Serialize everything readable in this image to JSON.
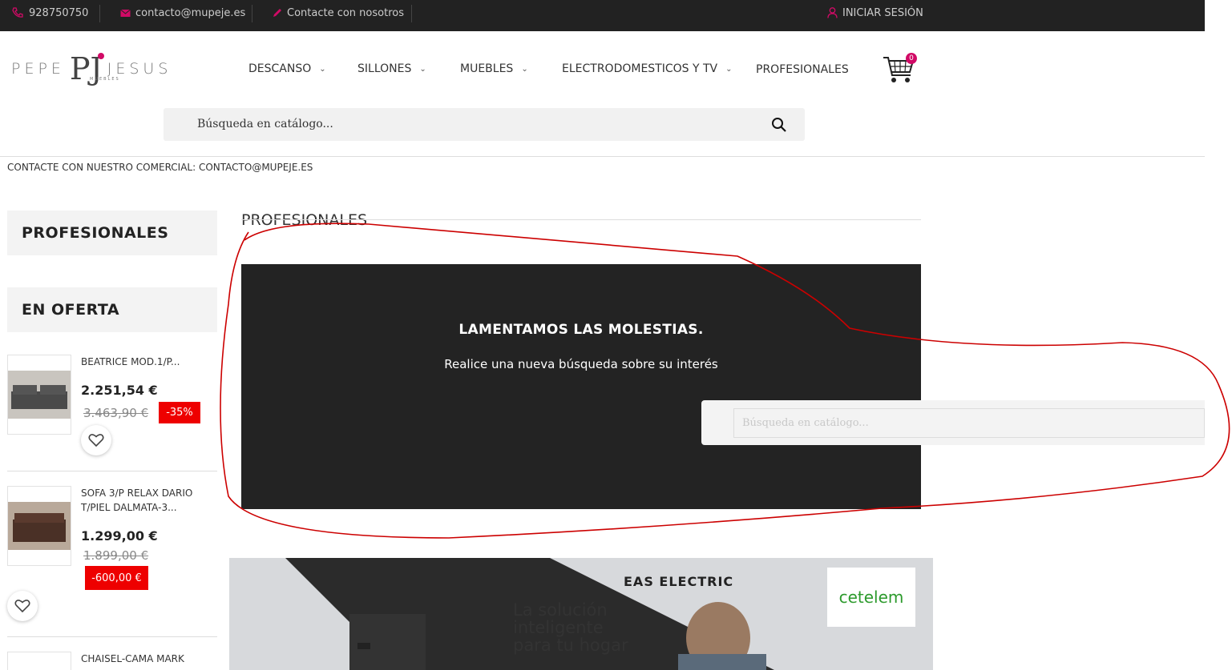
{
  "topbar": {
    "phone": "928750750",
    "email": "contacto@mupeje.es",
    "contact": "Contacte con nosotros",
    "login": "INICIAR SESIÓN"
  },
  "logo": {
    "left": "PEPE",
    "mark": "PJ",
    "right": "JESUS",
    "sub": "MUEBLES"
  },
  "nav": [
    {
      "label": "DESCANSO"
    },
    {
      "label": "SILLONES"
    },
    {
      "label": "MUEBLES"
    },
    {
      "label": "ELECTRODOMESTICOS Y TV"
    },
    {
      "label": "PROFESIONALES"
    }
  ],
  "cart": {
    "count": "0"
  },
  "search": {
    "placeholder": "Búsqueda en catálogo..."
  },
  "notice": "CONTACTE CON NUESTRO COMERCIAL: CONTACTO@MUPEJE.ES",
  "sidebar": {
    "category": "PROFESIONALES",
    "offers_title": "EN OFERTA",
    "products": [
      {
        "name": "BEATRICE MOD.1/P...",
        "price": "2.251,54 €",
        "old_price": "3.463,90 €",
        "discount": "-35%"
      },
      {
        "name": "SOFA 3/P RELAX DARIO T/PIEL DALMATA-3...",
        "price": "1.299,00 €",
        "old_price": "1.899,00 €",
        "discount": "-600,00 €"
      },
      {
        "name": "CHAISEL-CAMA MARK"
      }
    ]
  },
  "main": {
    "title": "PROFESIONALES",
    "sorry_title": "LAMENTAMOS LAS MOLESTIAS.",
    "sorry_text": "Realice una nueva búsqueda sobre su interés",
    "search_placeholder": "Búsqueda en catálogo..."
  },
  "banner": {
    "brand": "EAS ELECTRIC",
    "tagline_1": "La solución",
    "tagline_2": "inteligente",
    "tagline_3": "para tu hogar",
    "partner": "cetelem"
  },
  "colors": {
    "accent": "#d10a66",
    "topbar": "#222222",
    "discount": "#ee0000",
    "annotation": "#cc0000"
  }
}
